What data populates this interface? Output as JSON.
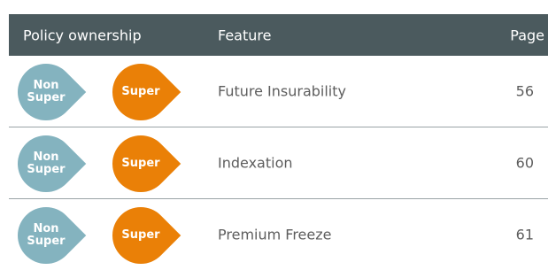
{
  "colors": {
    "header_bg": "#4b5a5e",
    "non_super": "#84b3bf",
    "super": "#ea8007"
  },
  "header": {
    "ownership_label": "Policy ownership",
    "feature_label": "Feature",
    "page_label": "Page"
  },
  "rows": [
    {
      "non_super_label": [
        "Non",
        "Super"
      ],
      "super_label": "Super",
      "feature": "Future Insurability",
      "page": "56"
    },
    {
      "non_super_label": [
        "Non",
        "Super"
      ],
      "super_label": "Super",
      "feature": "Indexation",
      "page": "60"
    },
    {
      "non_super_label": [
        "Non",
        "Super"
      ],
      "super_label": "Super",
      "feature": "Premium Freeze",
      "page": "61"
    }
  ]
}
